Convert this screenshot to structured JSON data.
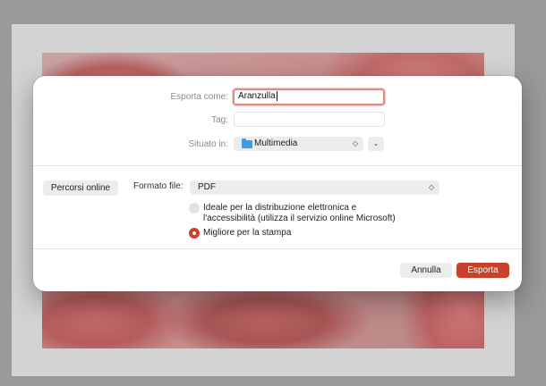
{
  "dialog": {
    "export_as_label": "Esporta come:",
    "export_as_value": "Aranzulla",
    "tag_label": "Tag:",
    "tag_value": "",
    "location_label": "Situato in:",
    "location_value": "Multimedia",
    "online_locations_button": "Percorsi online",
    "format_label": "Formato file:",
    "format_value": "PDF",
    "option_electronic_line1": "Ideale per la distribuzione elettronica e",
    "option_electronic_line2": "l'accessibilità (utilizza il servizio online Microsoft)",
    "option_print": "Migliore per la stampa",
    "selected_option": "Migliore per la stampa",
    "cancel_button": "Annulla",
    "export_button": "Esporta"
  },
  "colors": {
    "accent": "#c8412b",
    "focus_ring": "#d98f86",
    "folder_icon": "#3aa0e6"
  },
  "icons": {
    "location_folder": "folder-icon",
    "popup_arrows": "updown-chevron-icon",
    "expand": "chevron-down-icon"
  }
}
